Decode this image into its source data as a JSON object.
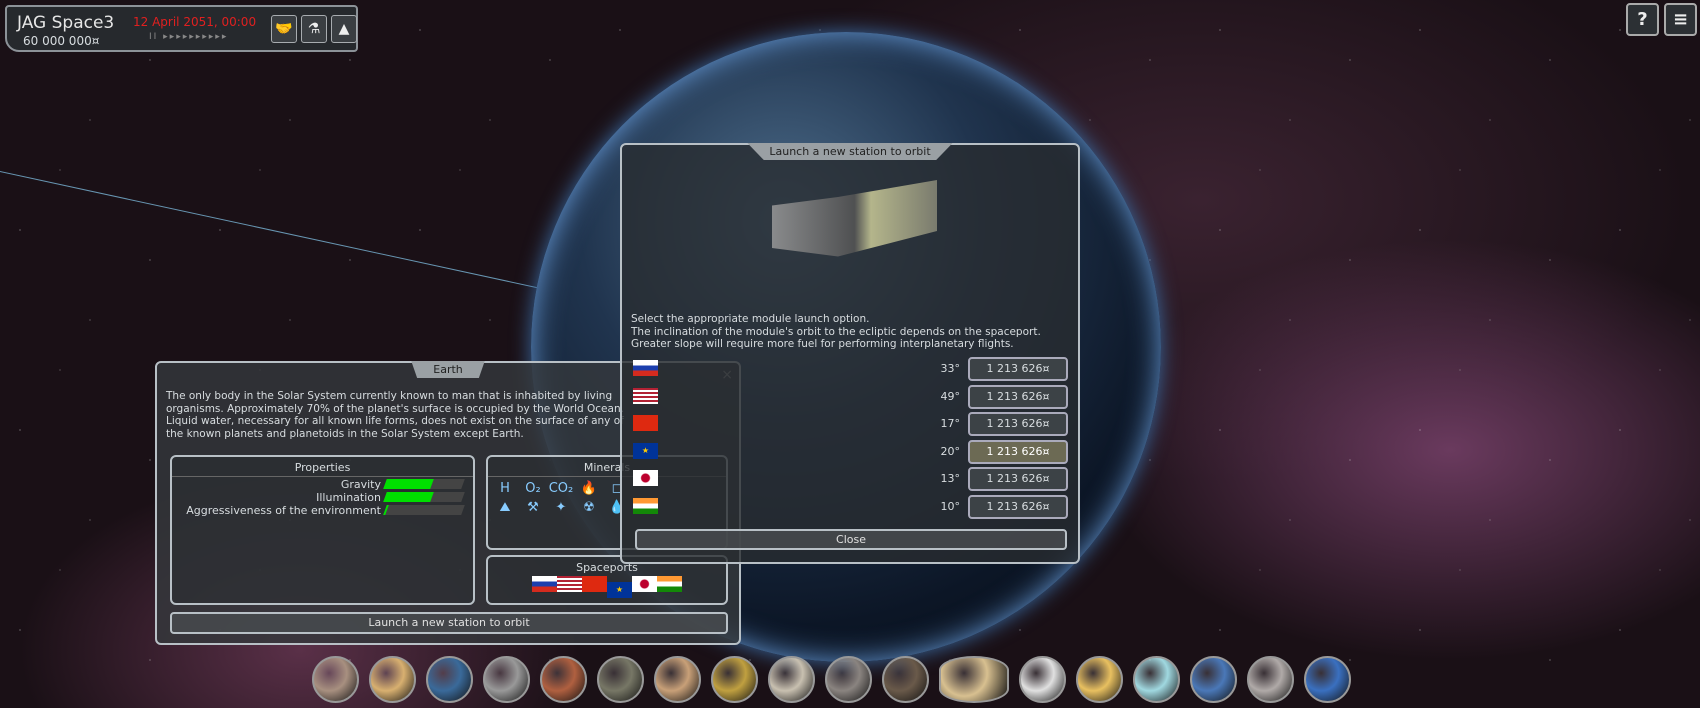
{
  "hud": {
    "company": "JAG Space3",
    "money": "60 000 000¤",
    "date": "12 April 2051, 00:00",
    "speed": "II ▸▸▸▸▸▸▸▸▸▸"
  },
  "hud_buttons": [
    "handshake-icon",
    "flask-icon",
    "rocket-icon"
  ],
  "top_right": {
    "help": "?",
    "menu": "≡"
  },
  "launch_dialog": {
    "title": "Launch a new station to orbit",
    "lines": [
      "Select the appropriate module launch option.",
      "The inclination of the module's orbit to the ecliptic depends on the spaceport.",
      "Greater slope will require more fuel for performing interplanetary flights."
    ],
    "options": [
      {
        "flag": "ru",
        "angle": "33°",
        "price": "1 213 626¤"
      },
      {
        "flag": "us",
        "angle": "49°",
        "price": "1 213 626¤"
      },
      {
        "flag": "cn",
        "angle": "17°",
        "price": "1 213 626¤"
      },
      {
        "flag": "eu",
        "angle": "20°",
        "price": "1 213 626¤",
        "selected": true
      },
      {
        "flag": "jp",
        "angle": "13°",
        "price": "1 213 626¤"
      },
      {
        "flag": "in",
        "angle": "10°",
        "price": "1 213 626¤"
      }
    ],
    "close": "Close"
  },
  "earth_panel": {
    "title": "Earth",
    "close": "×",
    "description": "The only body in the Solar System currently known to man that is inhabited by living organisms. Approximately 70% of the planet's surface is occupied by the World Ocean. Liquid water, necessary for all known life forms, does not exist on the surface of any of the known planets and planetoids in the Solar System except Earth.",
    "properties": {
      "title": "Properties",
      "items": [
        {
          "label": "Gravity",
          "value": 0.6
        },
        {
          "label": "Illumination",
          "value": 0.6
        },
        {
          "label": "Aggressiveness of the environment",
          "value": 0.02
        }
      ]
    },
    "minerals": {
      "title": "Minerals",
      "icons": [
        "H",
        "O₂",
        "CO₂",
        "🔥",
        "◻",
        "⛰",
        "⚒",
        "✦",
        "☢",
        "💧"
      ]
    },
    "spaceports": {
      "title": "Spaceports",
      "flags": [
        "ru",
        "us",
        "cn",
        "eu",
        "jp",
        "in"
      ]
    },
    "launch_button": "Launch a new station to orbit"
  },
  "planets": [
    "Mercury",
    "Venus",
    "Earth",
    "Moon",
    "Mars",
    "Phobos",
    "Jupiter",
    "Io",
    "Europa",
    "Ganymede",
    "Callisto",
    "Saturn",
    "Titan",
    "Enceladus",
    "Uranus",
    "Neptune",
    "Pluto",
    "Asteroids"
  ],
  "colors": {
    "accent": "#e02020",
    "bar": "#00e000"
  }
}
